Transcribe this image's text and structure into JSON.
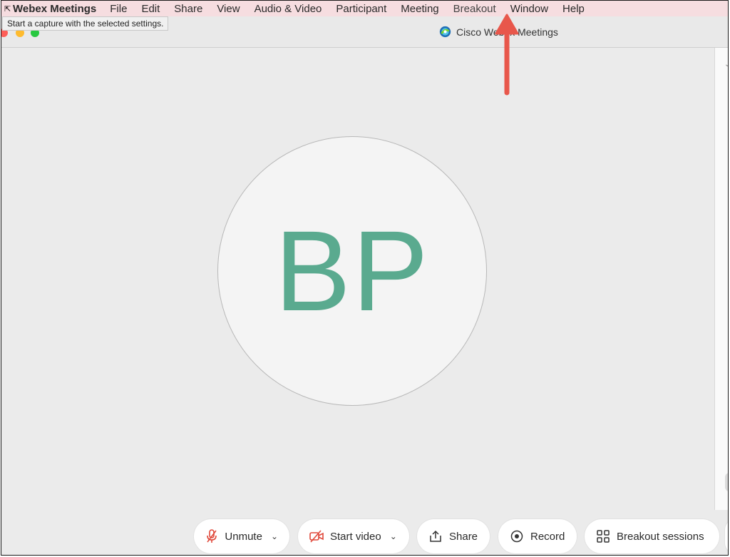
{
  "menubar": {
    "app_name": "Webex Meetings",
    "items": [
      "File",
      "Edit",
      "Share",
      "View",
      "Audio & Video",
      "Participant",
      "Meeting",
      "Breakout",
      "Window",
      "Help"
    ]
  },
  "tooltip": {
    "text": "Start a capture with the selected settings."
  },
  "window": {
    "title": "Cisco Webex Meetings"
  },
  "participant": {
    "initials": "BP",
    "color": "#5aaa8f"
  },
  "controls": {
    "unmute_label": "Unmute",
    "start_video_label": "Start video",
    "share_label": "Share",
    "record_label": "Record",
    "breakout_label": "Breakout sessions"
  },
  "colors": {
    "mic_muted": "#e0483a",
    "annotation_arrow": "#e8574b",
    "menubar_bg": "#f6dde0"
  },
  "icons": [
    "mic-off-icon",
    "video-off-icon",
    "share-icon",
    "record-icon",
    "breakout-grid-icon",
    "webex-logo-icon"
  ]
}
